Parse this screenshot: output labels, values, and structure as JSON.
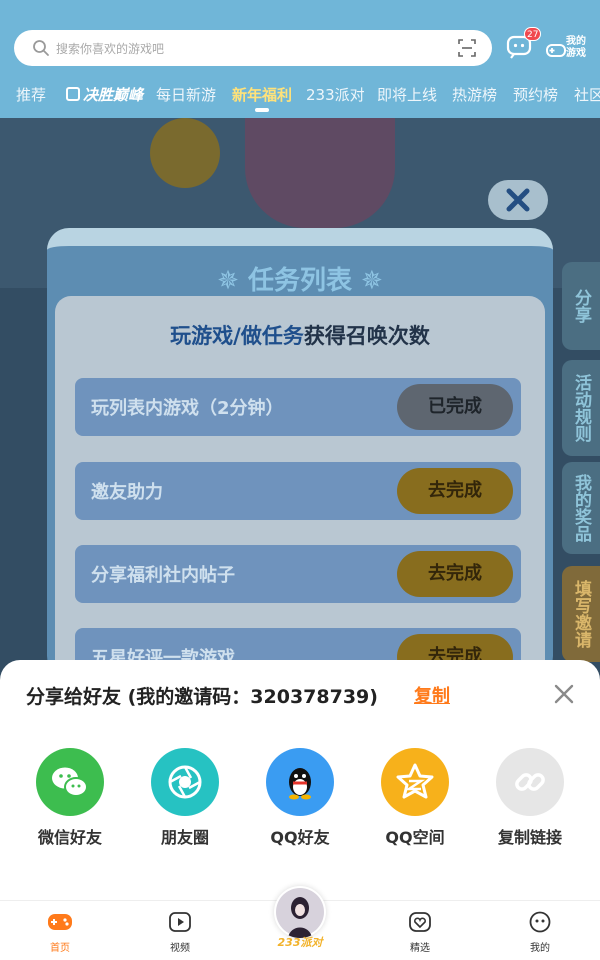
{
  "search": {
    "placeholder": "搜索你喜欢的游戏吧"
  },
  "header": {
    "message_badge": "27",
    "my_games_label_1": "我的",
    "my_games_label_2": "游戏"
  },
  "tabs": [
    "推荐",
    "决胜巅峰",
    "每日新游",
    "新年福利",
    "233派对",
    "即将上线",
    "热游榜",
    "预约榜",
    "社区"
  ],
  "active_tab": "新年福利",
  "side_labels": {
    "share": "分享",
    "rules": "活动规则",
    "prizes": "我的奖品",
    "invite": "填写邀请"
  },
  "task_panel": {
    "title": "任务列表",
    "subtitle_highlight": "玩游戏/做任务",
    "subtitle_rest": "获得召唤次数",
    "tasks": [
      {
        "label": "玩列表内游戏（2分钟）",
        "button": "已完成",
        "done": true
      },
      {
        "label": "邀友助力",
        "button": "去完成",
        "done": false
      },
      {
        "label": "分享福利社内帖子",
        "button": "去完成",
        "done": false
      },
      {
        "label": "五星好评一款游戏",
        "button": "去完成",
        "done": false
      }
    ]
  },
  "share_sheet": {
    "title": "分享给好友 (我的邀请码：320378739)",
    "copy_label": "复制",
    "options": [
      {
        "label": "微信好友",
        "icon": "wechat-icon",
        "color": "#3dbd4f"
      },
      {
        "label": "朋友圈",
        "icon": "moments-icon",
        "color": "#26c2c2"
      },
      {
        "label": "QQ好友",
        "icon": "qq-icon",
        "color": "#3a9cf2"
      },
      {
        "label": "QQ空间",
        "icon": "qzone-icon",
        "color": "#f7b11b"
      },
      {
        "label": "复制链接",
        "icon": "link-icon",
        "color": "#e6e6e6"
      }
    ]
  },
  "bottom_nav": [
    {
      "label": "首页",
      "icon": "gamepad-icon",
      "active": true
    },
    {
      "label": "视频",
      "icon": "video-icon",
      "active": false
    },
    {
      "label": "233派对",
      "icon": "party-avatar-icon",
      "active": false
    },
    {
      "label": "精选",
      "icon": "heart-icon",
      "active": false
    },
    {
      "label": "我的",
      "icon": "face-icon",
      "active": false
    }
  ]
}
